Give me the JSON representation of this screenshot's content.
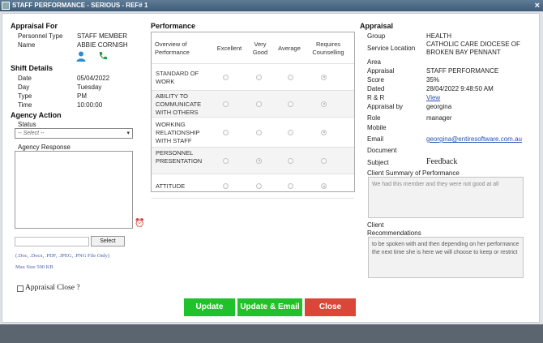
{
  "window": {
    "title": "STAFF PERFORMANCE - SERIOUS - REF# 1"
  },
  "appraisal_for": {
    "heading": "Appraisal For",
    "personnel_type_label": "Personnel Type",
    "personnel_type": "STAFF MEMBER",
    "name_label": "Name",
    "name": "ABBIE CORNISH"
  },
  "shift": {
    "heading": "Shift Details",
    "date_label": "Date",
    "date": "05/04/2022",
    "day_label": "Day",
    "day": "Tuesday",
    "type_label": "Type",
    "type": "PM",
    "time_label": "Time",
    "time": "10:00:00"
  },
  "agency": {
    "heading": "Agency Action",
    "status_label": "Status",
    "status_value": "-- Select --",
    "response_label": "Agency Response",
    "select_button": "Select",
    "file_note": "(.Doc, .Docx, .PDF, .JPEG, .PNG File Only)",
    "size_note": "Max Size 500 KB",
    "appraisal_close": "Appraisal Close ?"
  },
  "performance": {
    "heading": "Performance",
    "col_overview": "Overview of Performance",
    "columns": [
      "Excellent",
      "Very Good",
      "Average",
      "Requires Counselling"
    ],
    "rows": [
      {
        "label": "STANDARD OF WORK",
        "selected": 3
      },
      {
        "label": "ABILITY TO COMMUNICATE WITH OTHERS",
        "selected": 3
      },
      {
        "label": "WORKING RELATIONSHIP WITH STAFF",
        "selected": 3
      },
      {
        "label": "PERSONNEL PRESENTATION",
        "selected": 1
      },
      {
        "label": "ATTITUDE",
        "selected": 3
      }
    ]
  },
  "appraisal": {
    "heading": "Appraisal",
    "group_label": "Group",
    "group": "HEALTH",
    "location_label": "Service Location",
    "location": "CATHOLIC CARE DIOCESE OF BROKEN BAY PENNANT",
    "area_label": "Area",
    "appraisal_label": "Appraisal",
    "appraisal": "STAFF PERFORMANCE",
    "score_label": "Score",
    "score": "35%",
    "dated_label": "Dated",
    "dated": "28/04/2022 9:48:50 AM",
    "rr_label": "R & R",
    "rr_link": "View",
    "by_label": "Appraisal by",
    "by": "georgina",
    "role_label": "Role",
    "role": "manager",
    "mobile_label": "Mobile",
    "email_label": "Email",
    "email": "georgina@entiresoftware.com.au",
    "document_label": "Document",
    "subject_label": "Subject",
    "subject": "Feedback",
    "summary_label": "Client Summary of Performance",
    "summary": "We had this member and they were not good at all",
    "reco_label": "Client Recommendations",
    "recommendations": "to be spoken with and then depending on her performance the next time she is here we will choose to keep or restrict"
  },
  "buttons": {
    "update": "Update",
    "update_email": "Update & Email",
    "close": "Close"
  },
  "colors": {
    "green": "#1fc22a",
    "red": "#dc4638",
    "title_bar": "#3d5b77"
  }
}
